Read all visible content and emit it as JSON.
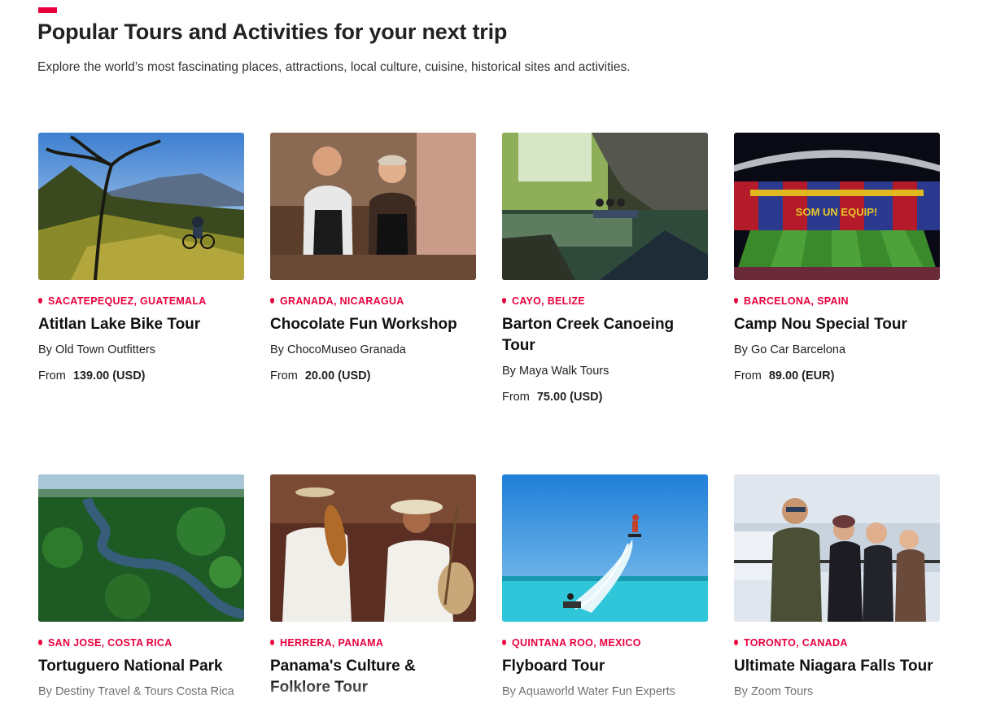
{
  "header": {
    "title": "Popular Tours and Activities for your next trip",
    "subtitle": "Explore the world’s most fascinating places, attractions, local culture, cuisine, historical sites and activities."
  },
  "colors": {
    "accent": "#e8003d",
    "text": "#222222"
  },
  "tours": [
    {
      "location": "SACATEPEQUEZ, GUATEMALA",
      "title": "Atitlan Lake Bike Tour",
      "by": "By Old Town Outfitters",
      "from_label": "From",
      "price": "139.00 (USD)",
      "image": "mountain-biker-photo"
    },
    {
      "location": "GRANADA, NICARAGUA",
      "title": "Chocolate Fun Workshop",
      "by": "By ChocoMuseo Granada",
      "from_label": "From",
      "price": "20.00 (USD)",
      "image": "chocolate-workshop-photo"
    },
    {
      "location": "CAYO, BELIZE",
      "title": "Barton Creek Canoeing Tour",
      "by": "By Maya Walk Tours",
      "from_label": "From",
      "price": "75.00 (USD)",
      "image": "cave-canoe-photo"
    },
    {
      "location": "BARCELONA, SPAIN",
      "title": "Camp Nou Special Tour",
      "by": "By Go Car Barcelona",
      "from_label": "From",
      "price": "89.00 (EUR)",
      "image": "stadium-photo",
      "stadium_banner": "SOM UN EQUIP!"
    },
    {
      "location": "SAN JOSE, COSTA RICA",
      "title": "Tortuguero National Park",
      "by": "By Destiny Travel & Tours Costa Rica",
      "image": "rainforest-river-photo"
    },
    {
      "location": "HERRERA, PANAMA",
      "title": "Panama's Culture & Folklore Tour",
      "by": "",
      "image": "folklore-musicians-photo"
    },
    {
      "location": "QUINTANA ROO, MEXICO",
      "title": "Flyboard Tour",
      "by": "By Aquaworld Water Fun Experts",
      "image": "flyboard-photo"
    },
    {
      "location": "TORONTO, CANADA",
      "title": "Ultimate Niagara Falls Tour",
      "by": "By Zoom Tours",
      "image": "niagara-group-photo"
    }
  ]
}
